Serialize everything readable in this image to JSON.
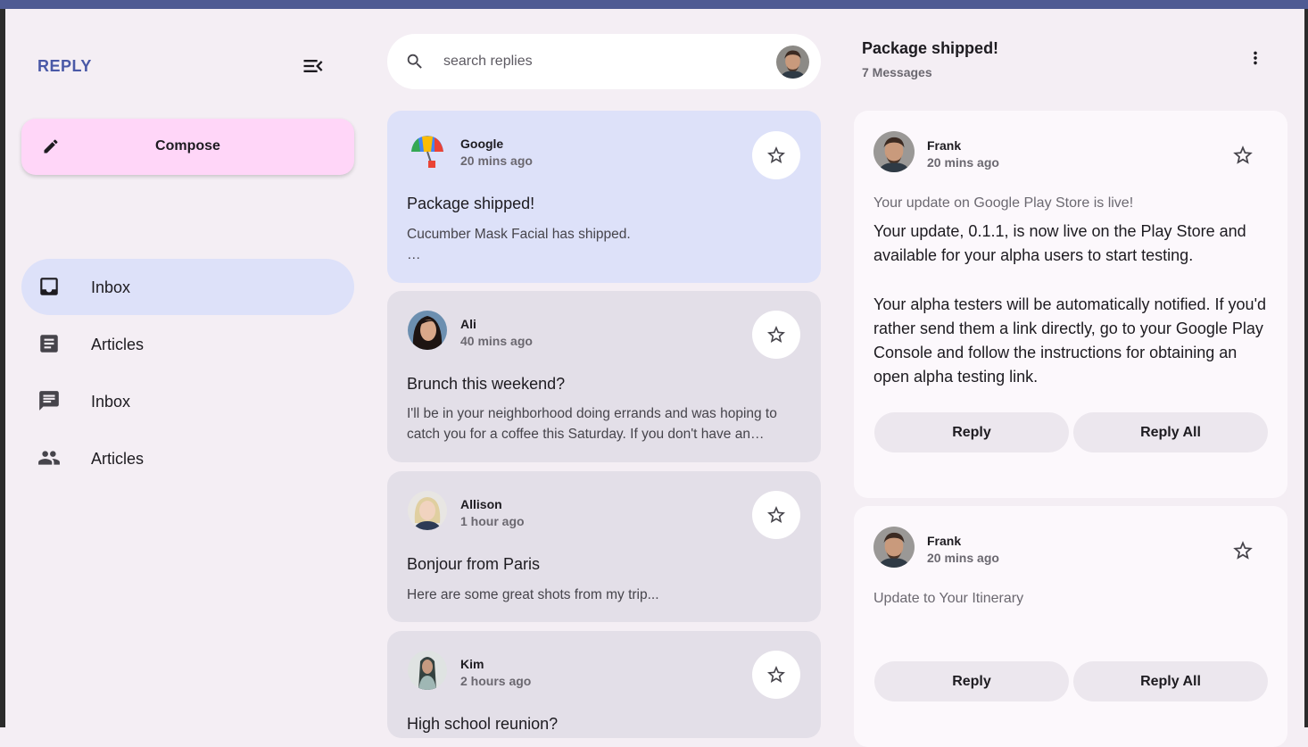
{
  "app": {
    "brand": "REPLY"
  },
  "compose": {
    "label": "Compose"
  },
  "nav": [
    {
      "label": "Inbox",
      "icon": "inbox-icon",
      "active": true
    },
    {
      "label": "Articles",
      "icon": "article-icon",
      "active": false
    },
    {
      "label": "Inbox",
      "icon": "chat-icon",
      "active": false
    },
    {
      "label": "Articles",
      "icon": "people-icon",
      "active": false
    }
  ],
  "search": {
    "placeholder": "search replies"
  },
  "emails": [
    {
      "sender": "Google",
      "time": "20 mins ago",
      "subject": "Package shipped!",
      "preview": "Cucumber Mask Facial has shipped.",
      "preview_more": "…",
      "selected": true
    },
    {
      "sender": "Ali",
      "time": "40 mins ago",
      "subject": "Brunch this weekend?",
      "preview": "I'll be in your neighborhood doing errands and was hoping to catch you for a coffee this Saturday. If you don't have an…"
    },
    {
      "sender": "Allison",
      "time": "1 hour ago",
      "subject": "Bonjour from Paris",
      "preview": "Here are some great shots from my trip..."
    },
    {
      "sender": "Kim",
      "time": "2 hours ago",
      "subject": "High school reunion?",
      "preview": ""
    }
  ],
  "detail": {
    "title": "Package shipped!",
    "count": "7 Messages",
    "messages": [
      {
        "sender": "Frank",
        "time": "20 mins ago",
        "subject": "Your update on Google Play Store is live!",
        "body_1": "Your update, 0.1.1, is now live on the Play Store and available for your alpha users to start testing.",
        "body_2": "Your alpha testers will be automatically notified. If you'd rather send them a link directly, go to your Google Play Console and follow the instructions for obtaining an open alpha testing link.",
        "reply": "Reply",
        "reply_all": "Reply All"
      },
      {
        "sender": "Frank",
        "time": "20 mins ago",
        "subject": "Update to Your Itinerary",
        "reply": "Reply",
        "reply_all": "Reply All"
      }
    ]
  },
  "colors": {
    "accent": "#4a59a7",
    "compose_bg": "#ffd6f8",
    "selected_bg": "#dde1f9",
    "card_bg": "#e3dfe8",
    "pane_bg": "#f4eef4"
  }
}
